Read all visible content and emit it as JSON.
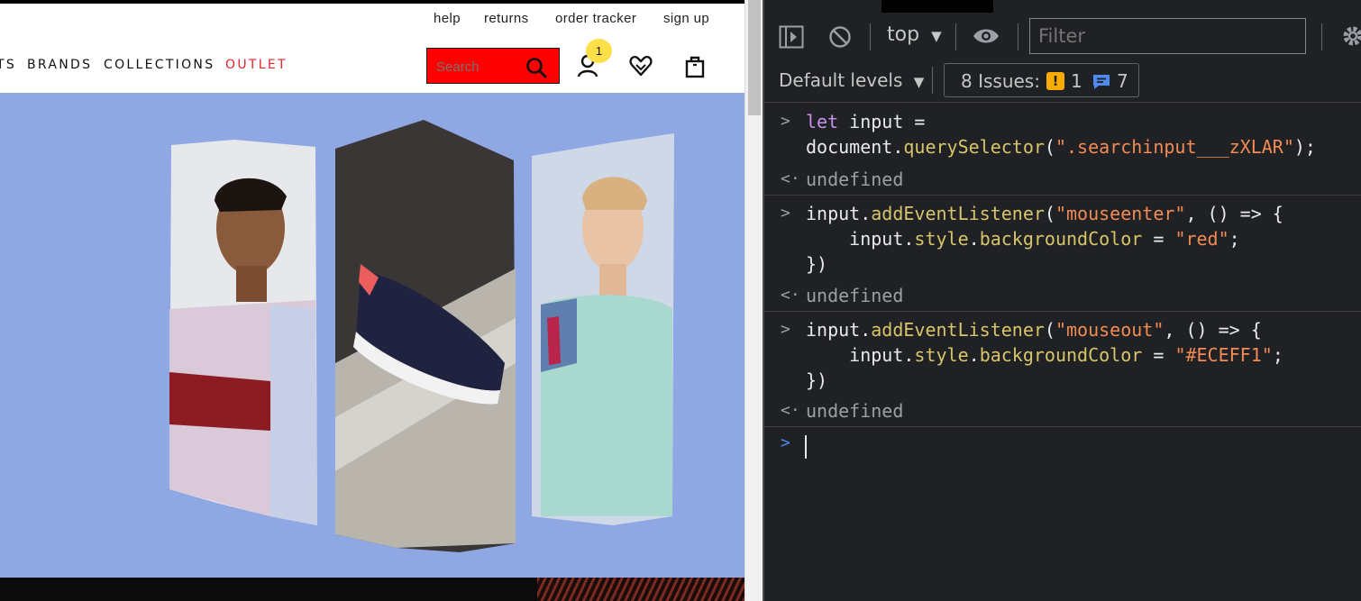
{
  "site": {
    "utility_links": [
      "help",
      "returns",
      "order tracker",
      "sign up"
    ],
    "nav_links": [
      "TS",
      "BRANDS",
      "COLLECTIONS",
      "OUTLET"
    ],
    "search_placeholder": "Search",
    "cart_count": "1",
    "colors": {
      "search_bg": "#ff0000",
      "outlet": "#e3242b",
      "hero_bg": "#8fa8e4",
      "badge": "#fde047"
    },
    "icons": [
      "search-icon",
      "account-icon",
      "wishlist-icon",
      "bag-icon"
    ]
  },
  "devtools": {
    "context": "top",
    "filter_placeholder": "Filter",
    "levels_label": "Default levels",
    "issues_label": "8 Issues:",
    "issues_warning_count": "1",
    "issues_info_count": "7",
    "console": {
      "entries": [
        {
          "lines": [
            [
              [
                "kw",
                "let"
              ],
              [
                "",
                " input ="
              ]
            ],
            [
              [
                "",
                "document."
              ],
              [
                "fn",
                "querySelector"
              ],
              [
                "",
                "("
              ],
              [
                "str",
                "\".searchinput___zXLAR\""
              ],
              [
                "",
                ");"
              ]
            ]
          ],
          "result": "undefined"
        },
        {
          "lines": [
            [
              [
                "",
                "input."
              ],
              [
                "fn",
                "addEventListener"
              ],
              [
                "",
                "("
              ],
              [
                "str",
                "\"mouseenter\""
              ],
              [
                "",
                ", () => {"
              ]
            ],
            [
              [
                "",
                "    input."
              ],
              [
                "fn",
                "style"
              ],
              [
                "",
                "."
              ],
              [
                "fn",
                "backgroundColor"
              ],
              [
                "",
                " = "
              ],
              [
                "str",
                "\"red\""
              ],
              [
                "",
                ";"
              ]
            ],
            [
              [
                "",
                "})"
              ]
            ]
          ],
          "result": "undefined"
        },
        {
          "lines": [
            [
              [
                "",
                "input."
              ],
              [
                "fn",
                "addEventListener"
              ],
              [
                "",
                "("
              ],
              [
                "str",
                "\"mouseout\""
              ],
              [
                "",
                ", () => {"
              ]
            ],
            [
              [
                "",
                "    input."
              ],
              [
                "fn",
                "style"
              ],
              [
                "",
                "."
              ],
              [
                "fn",
                "backgroundColor"
              ],
              [
                "",
                " = "
              ],
              [
                "str",
                "\"#ECEFF1\""
              ],
              [
                "",
                ";"
              ]
            ],
            [
              [
                "",
                "})"
              ]
            ]
          ],
          "result": "undefined"
        }
      ]
    }
  }
}
